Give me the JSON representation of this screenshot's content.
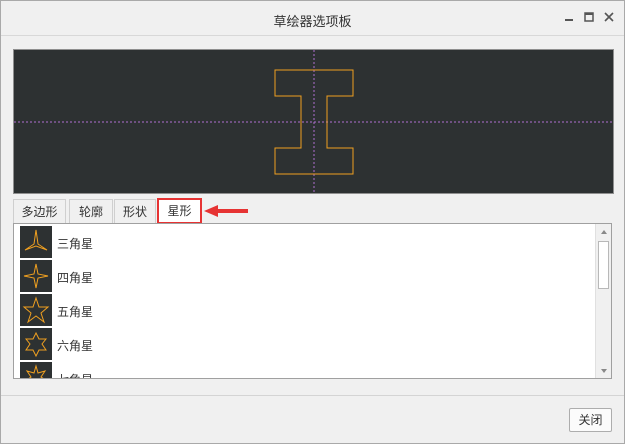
{
  "window": {
    "title": "草绘器选项板",
    "controls": {
      "minimize_icon": "minimize-icon",
      "maximize_icon": "maximize-icon",
      "close_icon": "close-icon"
    }
  },
  "preview": {
    "background": "#2d3132",
    "shape_color": "#f0a020",
    "guide_color": "#b070d0",
    "shape": "I-beam"
  },
  "tabs": [
    {
      "label": "多边形"
    },
    {
      "label": "轮廓"
    },
    {
      "label": "形状"
    },
    {
      "label": "星形",
      "active": true
    }
  ],
  "annotation_color": "#e63333",
  "items": [
    {
      "label": "三角星",
      "icon": "three-point-star-icon"
    },
    {
      "label": "四角星",
      "icon": "four-point-star-icon"
    },
    {
      "label": "五角星",
      "icon": "five-point-star-icon"
    },
    {
      "label": "六角星",
      "icon": "six-point-star-icon"
    },
    {
      "label": "七角星",
      "icon": "seven-point-star-icon"
    }
  ],
  "footer": {
    "close_label": "关闭"
  }
}
